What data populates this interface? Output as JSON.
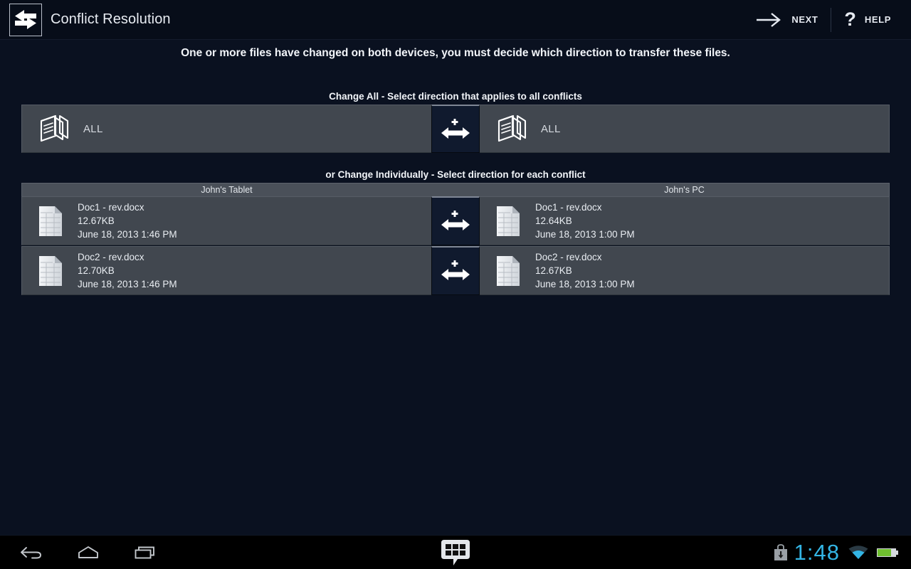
{
  "titlebar": {
    "app_icon_name": "transfer-arrows-icon",
    "title": "Conflict Resolution",
    "next": {
      "label": "NEXT",
      "icon": "arrow-right-icon"
    },
    "help": {
      "label": "HELP",
      "icon": "question-mark-icon"
    }
  },
  "instruction": "One or more files have changed on both devices, you must decide which direction to transfer these files.",
  "change_all": {
    "caption": "Change All - Select direction that applies to all conflicts",
    "left": {
      "label": "ALL",
      "icon": "document-stack-icon"
    },
    "right": {
      "label": "ALL",
      "icon": "document-stack-icon"
    },
    "direction_button": {
      "icon": "bidirectional-arrow-plus-icon"
    }
  },
  "change_individually": {
    "caption": "or Change Individually - Select direction for each conflict",
    "columns": {
      "left": "John's Tablet",
      "right": "John's PC"
    },
    "rows": [
      {
        "left": {
          "name": "Doc1 - rev.docx",
          "size": "12.67KB",
          "date": "June 18, 2013 1:46 PM",
          "icon": "document-icon"
        },
        "right": {
          "name": "Doc1 - rev.docx",
          "size": "12.64KB",
          "date": "June 18, 2013 1:00 PM",
          "icon": "document-icon"
        },
        "direction_button": {
          "icon": "bidirectional-arrow-plus-icon"
        }
      },
      {
        "left": {
          "name": "Doc2 - rev.docx",
          "size": "12.70KB",
          "date": "June 18, 2013 1:46 PM",
          "icon": "document-icon"
        },
        "right": {
          "name": "Doc2 - rev.docx",
          "size": "12.67KB",
          "date": "June 18, 2013 1:00 PM",
          "icon": "document-icon"
        },
        "direction_button": {
          "icon": "bidirectional-arrow-plus-icon"
        }
      }
    ]
  },
  "navbar": {
    "back_icon": "back-arrow-icon",
    "home_icon": "home-icon",
    "recents_icon": "recent-apps-icon",
    "keyboard_icon": "keyboard-ime-icon",
    "download_icon": "download-icon",
    "clock": "1:48",
    "wifi_icon": "wifi-icon",
    "battery_icon": "battery-icon"
  },
  "colors": {
    "page_background": "#0a1120",
    "panel": "#41474f",
    "column_header": "#4a5059",
    "direction_button": "#101a2e",
    "accent_cyan": "#33b5e5",
    "battery_green": "#6fbf2f",
    "text_primary": "#e9edf2"
  }
}
